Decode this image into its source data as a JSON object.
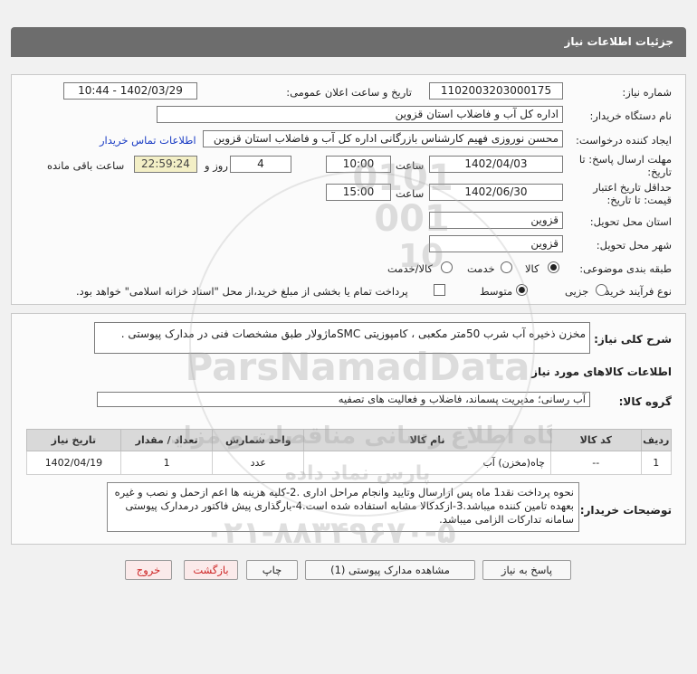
{
  "header": {
    "title": "جزئیات اطلاعات نیاز"
  },
  "form": {
    "need_number_label": "شماره نیاز:",
    "need_number": "1102003203000175",
    "announce_label": "تاریخ و ساعت اعلان عمومی:",
    "announce_value": "1402/03/29 - 10:44",
    "buyer_org_label": "نام دستگاه خریدار:",
    "buyer_org": "اداره کل آب و فاضلاب استان قزوین",
    "requester_label": "ایجاد کننده درخواست:",
    "requester": "محسن نوروزی فهیم کارشناس بازرگانی اداره کل آب و فاضلاب استان قزوین",
    "contact_link": "اطلاعات تماس خریدار",
    "deadline_label_1": "مهلت ارسال پاسخ: تا",
    "deadline_label_2": "تاریخ:",
    "deadline_date": "1402/04/03",
    "time_label": "ساعت",
    "deadline_time": "10:00",
    "days_value": "4",
    "days_label": "روز و",
    "remaining_time": "22:59:24",
    "remaining_label": "ساعت باقی مانده",
    "validity_label_1": "حداقل تاریخ اعتبار",
    "validity_label_2": "قیمت: تا تاریخ:",
    "validity_date": "1402/06/30",
    "validity_time_label": "ساعت",
    "validity_time": "15:00",
    "delivery_place_label": "استان محل تحویل:",
    "delivery_place": "قزوین",
    "delivery_city_label": "شهر محل تحویل:",
    "delivery_city": "قزوین",
    "category_label": "طبقه بندی موضوعی:",
    "category_options": [
      "کالا",
      "خدمت",
      "کالا/خدمت"
    ],
    "process_label": "نوع فرآیند خرید :",
    "process_options": [
      "جزیی",
      "متوسط"
    ],
    "payment_note": "پرداخت تمام یا بخشی از مبلغ خرید،از محل \"اسناد خزانه اسلامی\" خواهد بود."
  },
  "summary": {
    "label": "شرح کلی نیاز:",
    "text": "مخزن ذخیره آب شرب 50متر مکعبی ، کامپوزیتی SMCماژولار طبق مشخصات فنی در مدارک پیوستی ."
  },
  "goods": {
    "section_title": "اطلاعات کالاهای مورد نیاز",
    "group_label": "گروه کالا:",
    "group_value": "آب رسانی؛ مدیریت پسماند، فاضلاب و فعالیت های تصفیه",
    "columns": [
      "ردیف",
      "کد کالا",
      "نام کالا",
      "واحد شمارش",
      "تعداد / مقدار",
      "تاریخ نیاز"
    ],
    "rows": [
      {
        "row": "1",
        "code": "--",
        "name": "چاه(مخزن) آب",
        "unit": "عدد",
        "qty": "1",
        "date": "1402/04/19"
      }
    ]
  },
  "notes": {
    "label": "توضیحات خریدار:",
    "text": "نحوه پرداخت نقد1 ماه پس ازارسال وتایید وانجام مراحل اداری .2-کلیه هزینه ها اعم ازحمل و نصب و غیره بعهده تامین کننده میباشد.3-ازکدکالا مشابه استفاده شده است.4-بارگذاری پیش فاکتور  درمدارک پیوستی سامانه تدارکات الزامی میباشد."
  },
  "buttons": {
    "reply": "پاسخ به نیاز",
    "attachments": "مشاهده مدارک پیوستی (1)",
    "print": "چاپ",
    "back": "بازگشت",
    "exit": "خروج"
  },
  "watermark": {
    "number_lines": [
      "0101",
      "001",
      "10"
    ],
    "brand": "ParsNamadData",
    "line1": "پایگاه اطلاع رسانی مناقصات و مزایدات",
    "line2": "پارس نماد داده",
    "phone": "۰۲۱-۸۸۳۴۹۶۷۰-۵"
  },
  "colors": {
    "header_bg": "#6d6d6d",
    "link": "#1a3cc4",
    "remaining_bg": "#f3efc6",
    "exit_text": "#cc2222"
  }
}
